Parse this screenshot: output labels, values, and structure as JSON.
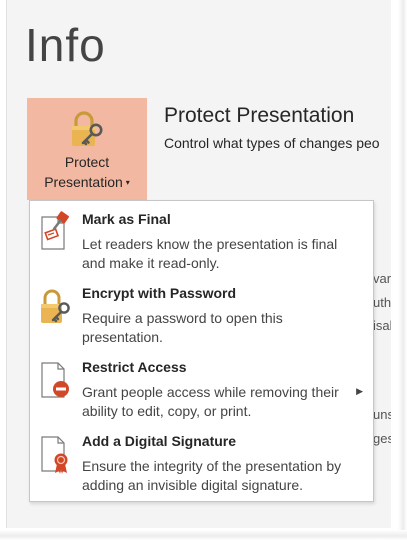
{
  "page": {
    "title": "Info"
  },
  "protect_button": {
    "label_line1": "Protect",
    "label_line2": "Presentation",
    "caret": "▾"
  },
  "section": {
    "title": "Protect Presentation",
    "description": "Control what types of changes peo"
  },
  "background_fragments": [
    "var",
    "uth",
    "isal",
    "uns",
    "ges"
  ],
  "menu": {
    "items": [
      {
        "title": "Mark as Final",
        "description": "Let readers know the presentation is final and make it read-only.",
        "icon": "mark-as-final-icon",
        "has_submenu": false
      },
      {
        "title": "Encrypt with Password",
        "description": "Require a password to open this presentation.",
        "icon": "padlock-key-icon",
        "has_submenu": false
      },
      {
        "title": "Restrict Access",
        "description": "Grant people access while removing their ability to edit, copy, or print.",
        "icon": "restrict-access-icon",
        "has_submenu": true
      },
      {
        "title": "Add a Digital Signature",
        "description": "Ensure the integrity of the presentation by adding an invisible digital signature.",
        "icon": "digital-signature-icon",
        "has_submenu": false
      }
    ],
    "submenu_arrow": "▶"
  },
  "colors": {
    "protect_button_bg": "#f3b8a2",
    "lock_gold": "#e9b451",
    "restrict_red": "#d24726",
    "backstage_bg": "#f4f4f4"
  }
}
